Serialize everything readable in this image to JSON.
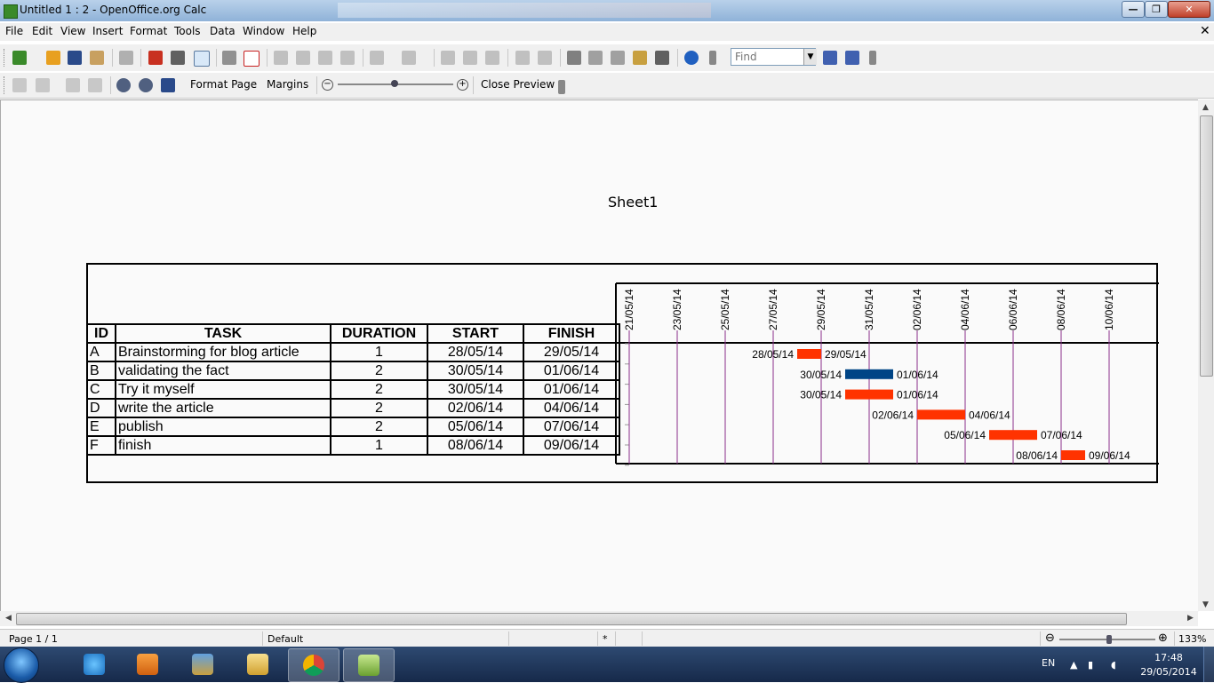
{
  "window": {
    "title": "Untitled 1 : 2 - OpenOffice.org Calc",
    "minimize_glyph": "—",
    "maximize_glyph": "❐",
    "close_glyph": "✕",
    "doc_close_glyph": "✕"
  },
  "menu": {
    "items": [
      {
        "label": "File",
        "name": "menu-file"
      },
      {
        "label": "Edit",
        "name": "menu-edit"
      },
      {
        "label": "View",
        "name": "menu-view"
      },
      {
        "label": "Insert",
        "name": "menu-insert"
      },
      {
        "label": "Format",
        "name": "menu-format"
      },
      {
        "label": "Tools",
        "name": "menu-tools"
      },
      {
        "label": "Data",
        "name": "menu-data"
      },
      {
        "label": "Window",
        "name": "menu-window"
      },
      {
        "label": "Help",
        "name": "menu-help"
      }
    ]
  },
  "toolbar": {
    "find_placeholder": "Find"
  },
  "preview_toolbar": {
    "format_page": "Format Page",
    "margins": "Margins",
    "close_preview": "Close Preview"
  },
  "page": {
    "sheet_name": "Sheet1"
  },
  "table": {
    "headers": [
      "ID",
      "TASK",
      "DURATION",
      "START",
      "FINISH"
    ],
    "rows": [
      {
        "id": "A",
        "task": "Brainstorming for blog article",
        "duration": "1",
        "start": "28/05/14",
        "finish": "29/05/14"
      },
      {
        "id": "B",
        "task": "validating the fact",
        "duration": "2",
        "start": "30/05/14",
        "finish": "01/06/14"
      },
      {
        "id": "C",
        "task": "Try it myself",
        "duration": "2",
        "start": "30/05/14",
        "finish": "01/06/14"
      },
      {
        "id": "D",
        "task": "write the article",
        "duration": "2",
        "start": "02/06/14",
        "finish": "04/06/14"
      },
      {
        "id": "E",
        "task": "publish",
        "duration": "2",
        "start": "05/06/14",
        "finish": "07/06/14"
      },
      {
        "id": "F",
        "task": "finish",
        "duration": "1",
        "start": "08/06/14",
        "finish": "09/06/14"
      }
    ]
  },
  "chart_data": {
    "type": "bar",
    "orientation": "horizontal-gantt",
    "x_ticks": [
      "21/05/14",
      "23/05/14",
      "25/05/14",
      "27/05/14",
      "29/05/14",
      "31/05/14",
      "02/06/14",
      "04/06/14",
      "06/06/14",
      "08/06/14",
      "10/06/14"
    ],
    "xlim": [
      "2014-05-21",
      "2014-06-11"
    ],
    "grid": true,
    "bars": [
      {
        "start": "2014-05-28",
        "end": "2014-05-29",
        "start_label": "28/05/14",
        "end_label": "29/05/14",
        "color": "#ff3300"
      },
      {
        "start": "2014-05-30",
        "end": "2014-06-01",
        "start_label": "30/05/14",
        "end_label": "01/06/14",
        "color": "#004586"
      },
      {
        "start": "2014-05-30",
        "end": "2014-06-01",
        "start_label": "30/05/14",
        "end_label": "01/06/14",
        "color": "#ff3300"
      },
      {
        "start": "2014-06-02",
        "end": "2014-06-04",
        "start_label": "02/06/14",
        "end_label": "04/06/14",
        "color": "#ff3300"
      },
      {
        "start": "2014-06-05",
        "end": "2014-06-07",
        "start_label": "05/06/14",
        "end_label": "07/06/14",
        "color": "#ff3300"
      },
      {
        "start": "2014-06-08",
        "end": "2014-06-09",
        "start_label": "08/06/14",
        "end_label": "09/06/14",
        "color": "#ff3300"
      }
    ],
    "gridline_color": "#8b2f8b"
  },
  "statusbar": {
    "page": "Page 1 / 1",
    "style": "Default",
    "modified": "*",
    "zoom": "133%"
  },
  "taskbar": {
    "lang": "EN",
    "time": "17:48",
    "date": "29/05/2014"
  },
  "colors": {
    "accent_red": "#ff3300",
    "accent_blue": "#004586"
  }
}
